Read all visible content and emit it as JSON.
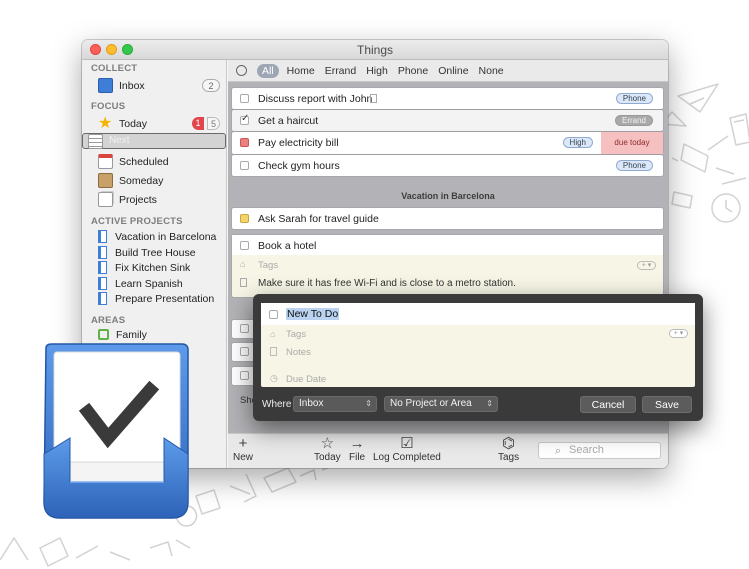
{
  "window": {
    "title": "Things"
  },
  "sidebar": {
    "collect_label": "COLLECT",
    "inbox": {
      "label": "Inbox",
      "count": "2"
    },
    "focus_label": "FOCUS",
    "today": {
      "label": "Today",
      "due": "1",
      "count": "5"
    },
    "next": {
      "label": "Next"
    },
    "scheduled": {
      "label": "Scheduled"
    },
    "someday": {
      "label": "Someday"
    },
    "projects": {
      "label": "Projects"
    },
    "active_projects_label": "ACTIVE PROJECTS",
    "active_projects": [
      "Vacation in Barcelona",
      "Build Tree House",
      "Fix Kitchen Sink",
      "Learn Spanish",
      "Prepare Presentation"
    ],
    "areas_label": "AREAS",
    "areas": [
      "Family"
    ]
  },
  "filters": [
    "All",
    "Home",
    "Errand",
    "High",
    "Phone",
    "Online",
    "None"
  ],
  "tasks": {
    "0": {
      "title": "Discuss report with John",
      "tag": "Phone"
    },
    "1": {
      "title": "Get a haircut",
      "tag": "Errand",
      "completed": true
    },
    "2": {
      "title": "Pay electricity bill",
      "tag": "High",
      "due": "due today"
    },
    "3": {
      "title": "Check gym hours",
      "tag": "Phone"
    },
    "heading": "Vacation in Barcelona",
    "4": {
      "title": "Ask Sarah for travel guide"
    },
    "5": {
      "title": "Book a hotel",
      "tags_placeholder": "Tags",
      "notes": "Make sure it has free Wi-Fi and is close to a metro station."
    },
    "show_more": "Sho"
  },
  "toolbar": {
    "new": "New",
    "today": "Today",
    "file": "File",
    "log_completed": "Log Completed",
    "tags": "Tags",
    "search_placeholder": "Search"
  },
  "quick_entry": {
    "title": "New To Do",
    "tags_placeholder": "Tags",
    "notes_placeholder": "Notes",
    "due_placeholder": "Due Date",
    "where_label": "Where",
    "where_value": "Inbox",
    "project_value": "No Project or Area",
    "cancel": "Cancel",
    "save": "Save"
  },
  "colors": {
    "accent_blue": "#3f7ed6",
    "today_badge_red": "#e2444b",
    "due_today_bg": "#f7c0c0",
    "quick_entry_bg": "#3a3a3a",
    "list_bg": "#b3b3b7"
  }
}
